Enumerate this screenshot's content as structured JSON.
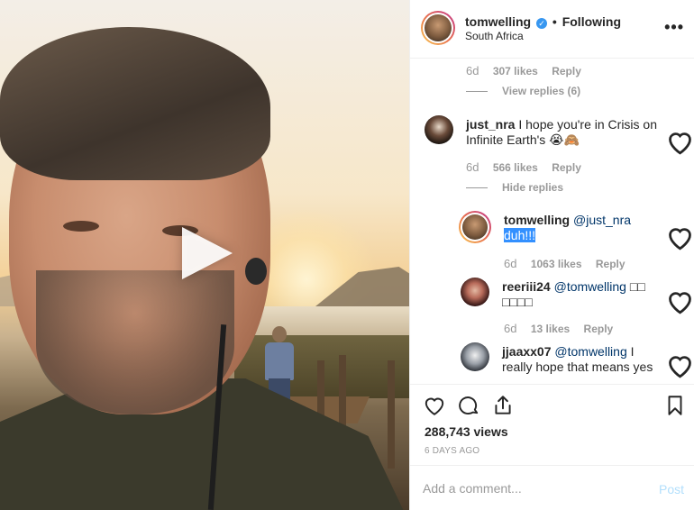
{
  "header": {
    "username": "tomwelling",
    "dot": "•",
    "follow_label": "Following",
    "location": "South Africa",
    "more_icon": "more-horizontal-icon"
  },
  "comments": {
    "prev_meta": {
      "age": "6d",
      "likes": "307 likes",
      "reply": "Reply"
    },
    "view_replies": "View replies (6)",
    "items": [
      {
        "user": "just_nra",
        "text": "I hope you're in Crisis on",
        "text_line2": "Infinite Earth's 😭🙈",
        "age": "6d",
        "likes": "566 likes",
        "reply": "Reply"
      },
      {
        "user": "tomwelling",
        "mention": "@just_nra",
        "text_selected": "duh!!!",
        "age": "6d",
        "likes": "1063 likes",
        "reply": "Reply"
      },
      {
        "user": "reeriii24",
        "mention": "@tomwelling",
        "text": "□□",
        "text_line2": "□□□□",
        "age": "6d",
        "likes": "13 likes",
        "reply": "Reply"
      },
      {
        "user": "jjaaxx07",
        "mention": "@tomwelling",
        "text": "I",
        "text_line2": "really hope that means yes"
      }
    ],
    "hide_replies": "Hide replies"
  },
  "actions": {
    "views": "288,743 views",
    "ago": "6 DAYS AGO"
  },
  "add_comment": {
    "placeholder": "Add a comment...",
    "post_label": "Post"
  },
  "colors": {
    "link": "#003569",
    "verified": "#3897f0",
    "post_disabled": "#b2dffc",
    "meta_gray": "#999999"
  }
}
